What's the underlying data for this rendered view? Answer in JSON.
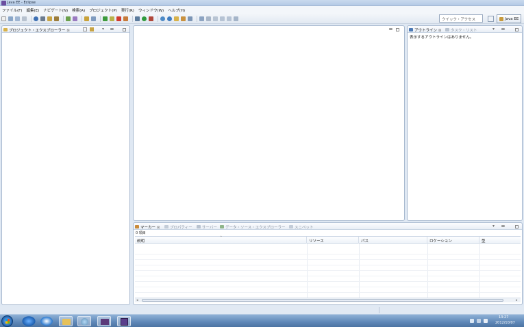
{
  "window": {
    "title": "Java EE - Eclipse"
  },
  "menu": [
    "ファイル(F)",
    "編集(E)",
    "ナビゲート(N)",
    "検索(A)",
    "プロジェクト(P)",
    "実行(R)",
    "ウィンドウ(W)",
    "ヘルプ(H)"
  ],
  "toolbar": {
    "quick_access_placeholder": "クイック・アクセス",
    "perspective_label": "Java EE"
  },
  "project_explorer": {
    "tab_label": "プロジェクト・エクスプローラー",
    "close_glyph": "⊠"
  },
  "editor": {
    "minimize_glyph": "▬",
    "maximize_glyph": ""
  },
  "outline": {
    "tabs": [
      {
        "label": "アウトライン",
        "active": true
      },
      {
        "label": "タスク・リスト",
        "active": false
      }
    ],
    "close_glyph": "⊠",
    "empty_message": "表示するアウトラインはありません。"
  },
  "bottom_panel": {
    "tabs": [
      {
        "label": "マーカー",
        "active": true
      },
      {
        "label": "プロパティー",
        "active": false
      },
      {
        "label": "サーバー",
        "active": false
      },
      {
        "label": "データ・ソース・エクスプローラー",
        "active": false
      },
      {
        "label": "スニペット",
        "active": false
      }
    ],
    "close_glyph": "⊠",
    "item_count": "0 項目",
    "columns": [
      "説明",
      "リソース",
      "パス",
      "ロケーション",
      "型"
    ],
    "sort_glyph": "^"
  },
  "taskbar": {
    "time": "13:27",
    "date": "2012/10/07"
  },
  "colors": {
    "panel_border": "#a9bad0",
    "toolbar_bg": "#e2e9f2",
    "taskbar": "#5f88b8"
  }
}
